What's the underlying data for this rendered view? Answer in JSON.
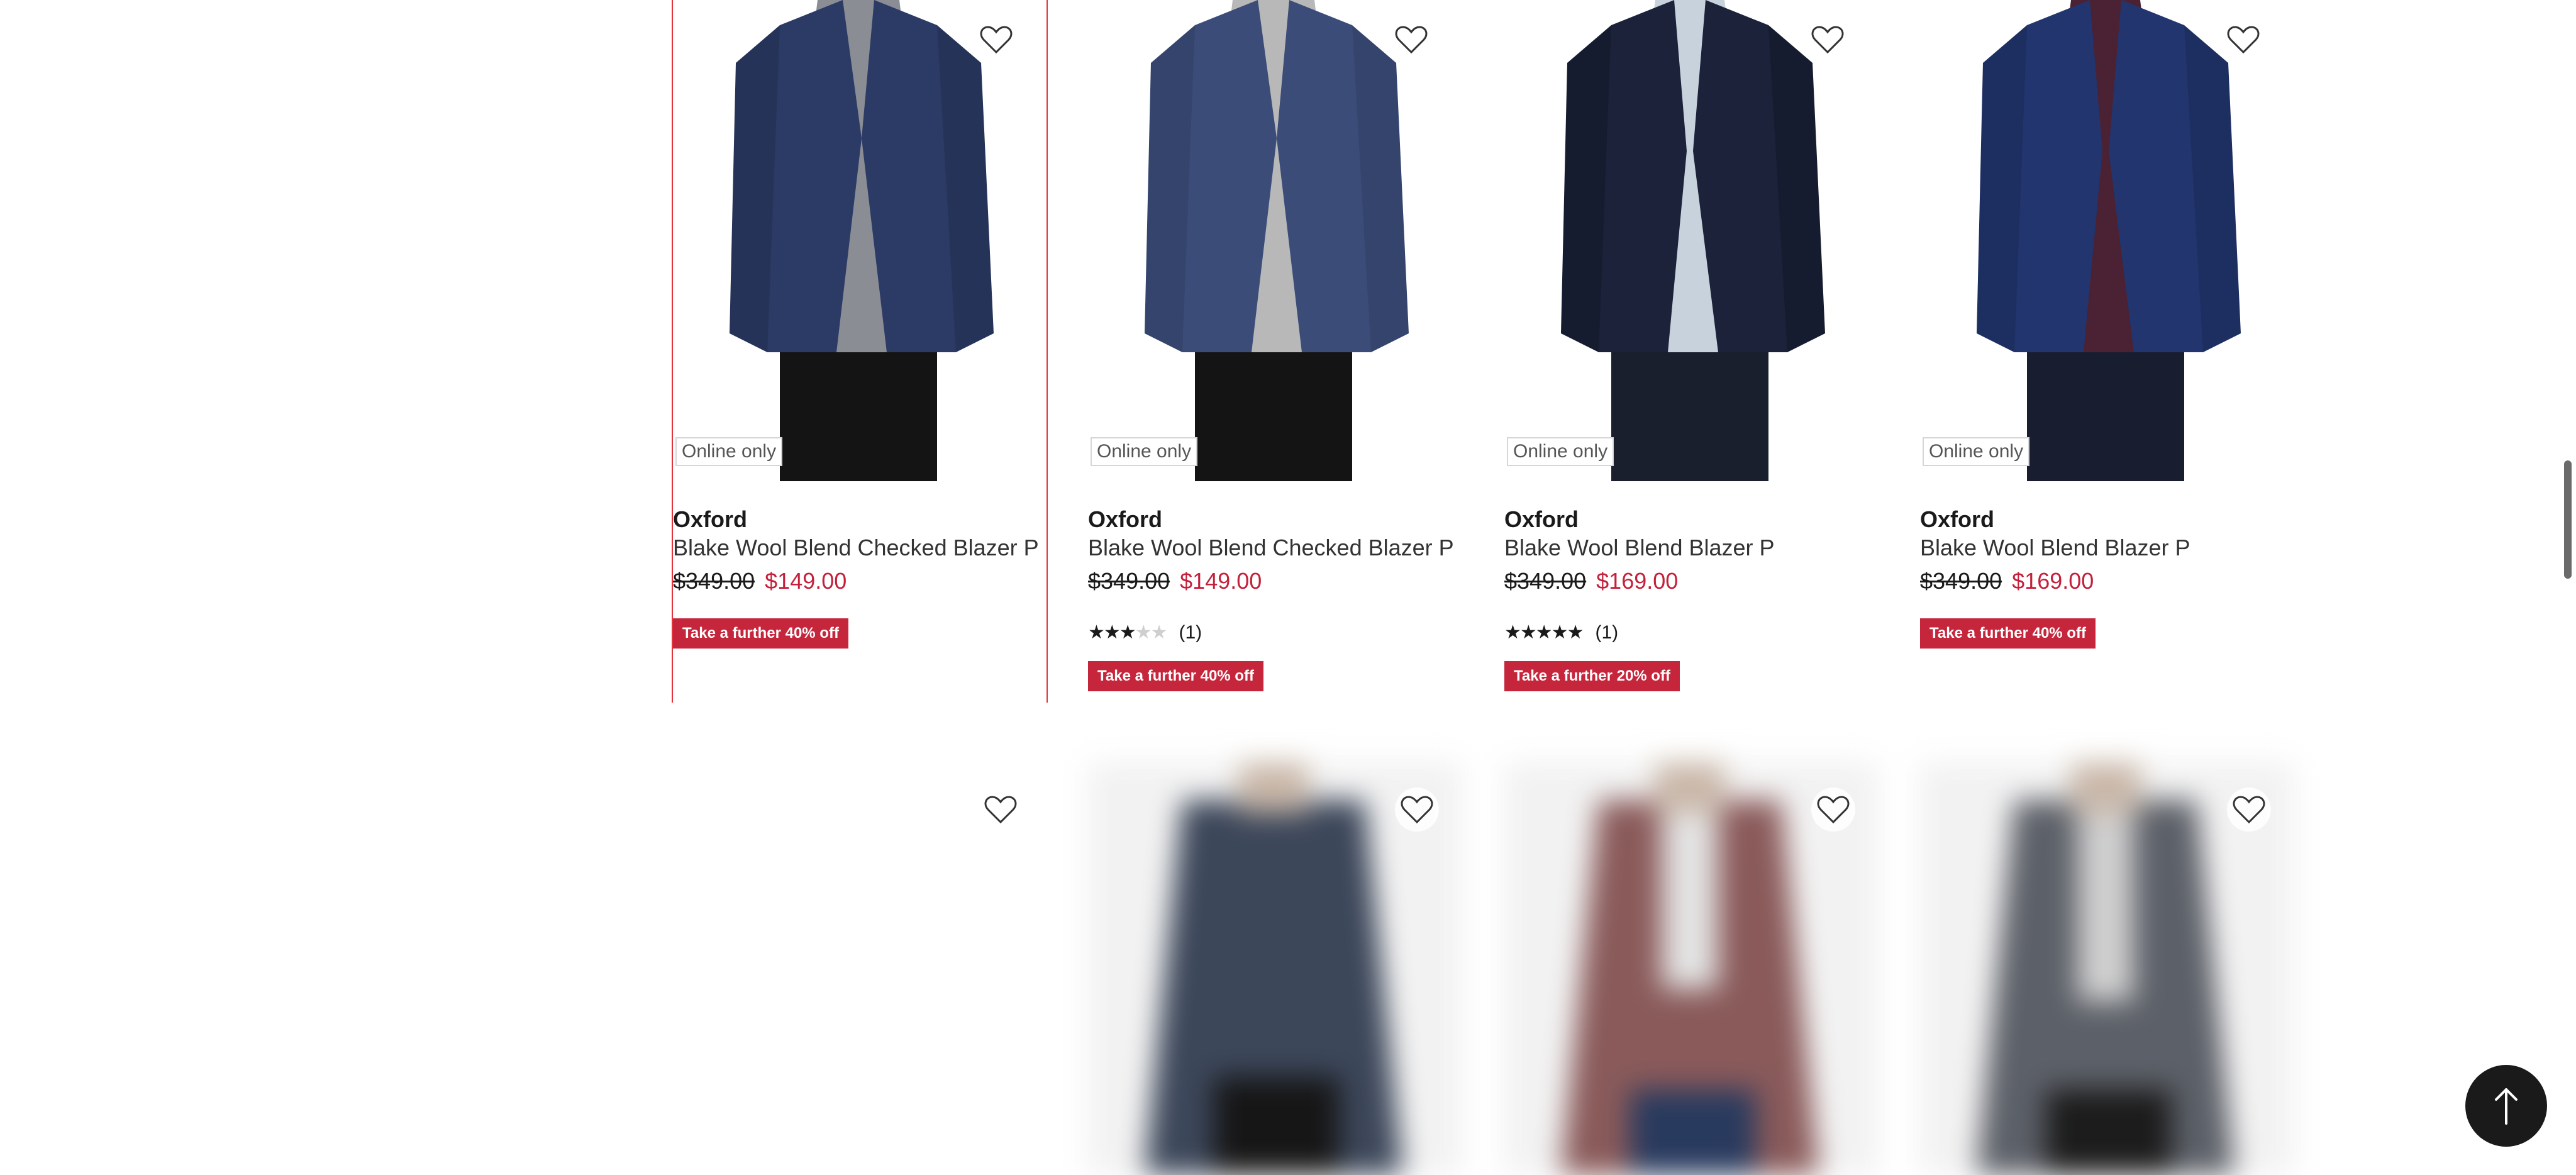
{
  "products": [
    {
      "badge": "Online only",
      "brand": "Oxford",
      "name": "Blake Wool Blend Checked Blazer P",
      "was_price": "$349.00",
      "now_price": "$149.00",
      "promo": "Take a further 40% off",
      "rating": null,
      "review_count": null,
      "jacket_color": "#2c3a66",
      "shirt_color": "#8a8d93"
    },
    {
      "badge": "Online only",
      "brand": "Oxford",
      "name": "Blake Wool Blend Checked Blazer P",
      "was_price": "$349.00",
      "now_price": "$149.00",
      "promo": "Take a further 40% off",
      "rating": 3,
      "review_count": "(1)",
      "jacket_color": "#3b4c78",
      "shirt_color": "#b8b8b8"
    },
    {
      "badge": "Online only",
      "brand": "Oxford",
      "name": "Blake Wool Blend Blazer P",
      "was_price": "$349.00",
      "now_price": "$169.00",
      "promo": "Take a further 20% off",
      "rating": 5,
      "review_count": "(1)",
      "jacket_color": "#1b223a",
      "shirt_color": "#c8d2dc"
    },
    {
      "badge": "Online only",
      "brand": "Oxford",
      "name": "Blake Wool Blend Blazer P",
      "was_price": "$349.00",
      "now_price": "$169.00",
      "promo": "Take a further 40% off",
      "rating": null,
      "review_count": null,
      "jacket_color": "#22356e",
      "shirt_color": "#4a2233"
    }
  ],
  "row2": [
    {
      "jacket_color": "#ffffff"
    },
    {
      "jacket_color": "#3c475a"
    },
    {
      "jacket_color": "#8a5a5a"
    },
    {
      "jacket_color": "#5c6068"
    }
  ],
  "colors": {
    "sale_red": "#c4203b",
    "promo_bg": "#c6263c",
    "focus_border": "#e0333c"
  },
  "icons": {
    "wishlist": "heart-icon",
    "back_to_top": "arrow-up-icon"
  }
}
